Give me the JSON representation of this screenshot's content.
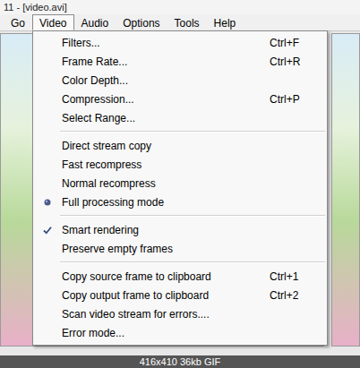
{
  "window": {
    "title": "11 - [video.avi]"
  },
  "menu_bar": [
    {
      "label": "Go",
      "selected": false
    },
    {
      "label": "Video",
      "selected": true
    },
    {
      "label": "Audio",
      "selected": false
    },
    {
      "label": "Options",
      "selected": false
    },
    {
      "label": "Tools",
      "selected": false
    },
    {
      "label": "Help",
      "selected": false
    }
  ],
  "menu": {
    "sections": [
      [
        {
          "label": "Filters...",
          "shortcut": "Ctrl+F",
          "kind": "command"
        },
        {
          "label": "Frame Rate...",
          "shortcut": "Ctrl+R",
          "kind": "command"
        },
        {
          "label": "Color Depth...",
          "kind": "command"
        },
        {
          "label": "Compression...",
          "shortcut": "Ctrl+P",
          "kind": "command"
        },
        {
          "label": "Select Range...",
          "kind": "command"
        }
      ],
      [
        {
          "label": "Direct stream copy",
          "kind": "radio",
          "checked": false
        },
        {
          "label": "Fast recompress",
          "kind": "radio",
          "checked": false
        },
        {
          "label": "Normal recompress",
          "kind": "radio",
          "checked": false
        },
        {
          "label": "Full processing mode",
          "kind": "radio",
          "checked": true
        }
      ],
      [
        {
          "label": "Smart rendering",
          "kind": "toggle",
          "checked": true
        },
        {
          "label": "Preserve empty frames",
          "kind": "toggle",
          "checked": false
        }
      ],
      [
        {
          "label": "Copy source frame to clipboard",
          "shortcut": "Ctrl+1",
          "kind": "command"
        },
        {
          "label": "Copy output frame to clipboard",
          "shortcut": "Ctrl+2",
          "kind": "command"
        },
        {
          "label": "Scan video stream for errors....",
          "kind": "command"
        },
        {
          "label": "Error mode...",
          "kind": "command"
        }
      ]
    ]
  },
  "image_info": "416x410 36kb GIF"
}
